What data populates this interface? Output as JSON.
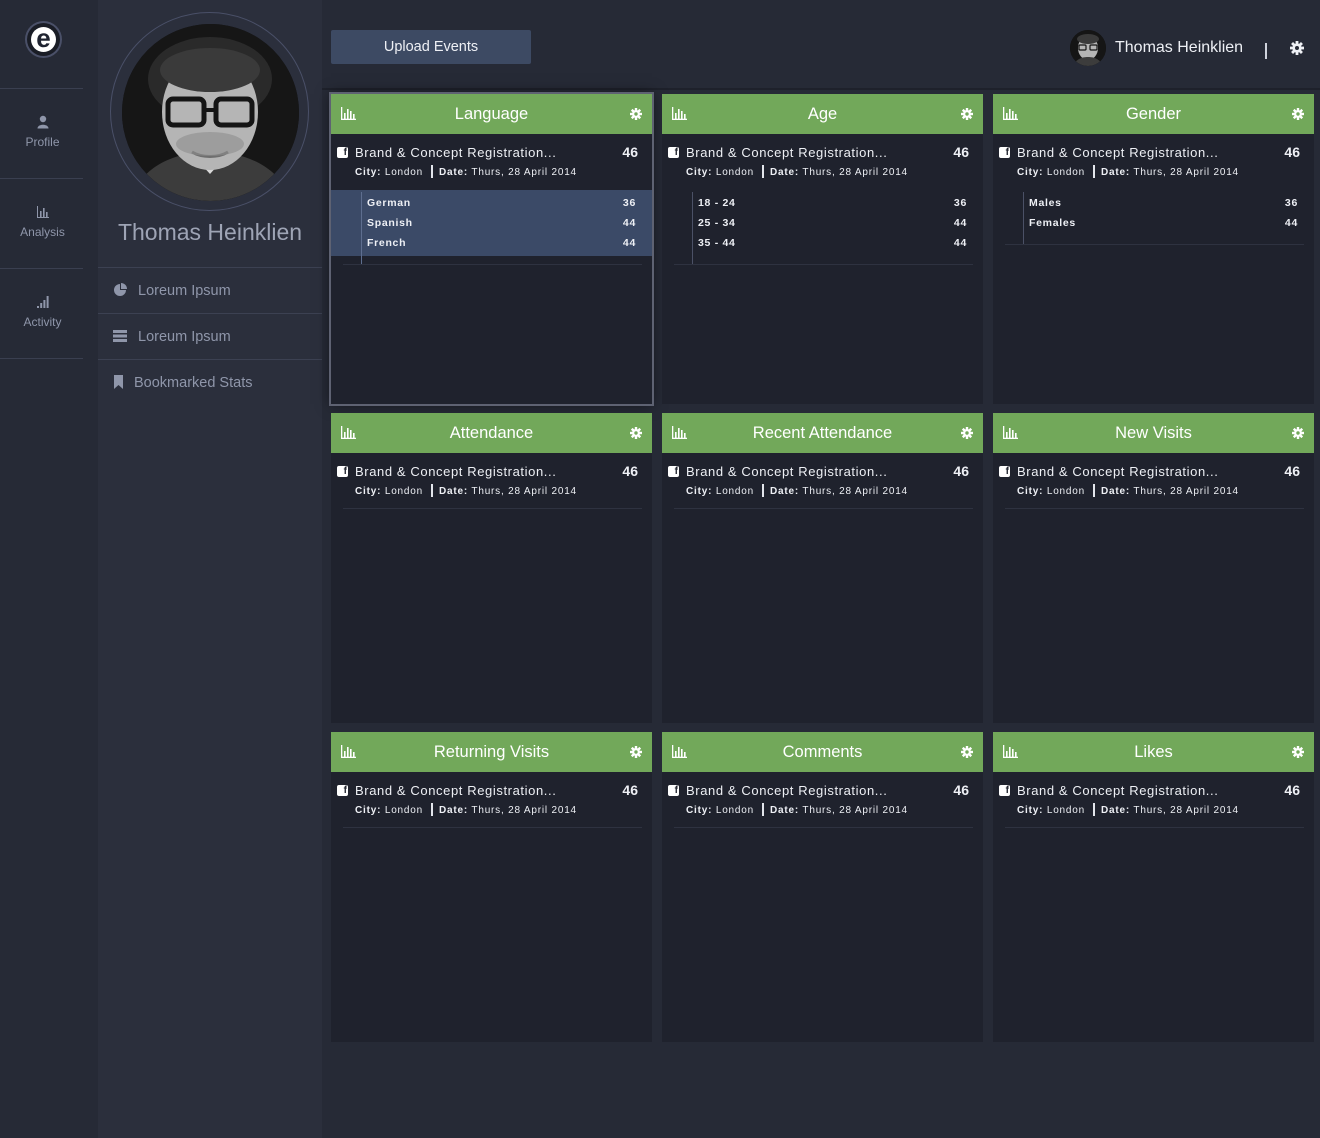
{
  "rail": {
    "logo_letter": "e",
    "items": [
      {
        "label": "Profile",
        "icon": "user-icon"
      },
      {
        "label": "Analysis",
        "icon": "bar-chart-icon"
      },
      {
        "label": "Activity",
        "icon": "signal-bars-icon"
      }
    ]
  },
  "profile": {
    "name": "Thomas Heinklien",
    "menu": [
      {
        "label": "Loreum Ipsum",
        "icon": "pie-chart-icon"
      },
      {
        "label": "Loreum Ipsum",
        "icon": "list-icon"
      },
      {
        "label": "Bookmarked Stats",
        "icon": "bookmark-icon"
      }
    ]
  },
  "topbar": {
    "upload_label": "Upload Events",
    "user_name": "Thomas Heinklien",
    "separator": "|"
  },
  "colors": {
    "accent_green": "#72a85a",
    "selected_row_bg": "#3b4a67",
    "card_bg": "#1f222d",
    "page_bg": "#262a36"
  },
  "cards": [
    {
      "title": "Language",
      "entry": {
        "title": "Brand & Concept Registration...",
        "count": "46",
        "city_label": "City:",
        "city": "London",
        "date_label": "Date:",
        "date": "Thurs, 28 April 2014"
      },
      "rows": [
        {
          "label": "German",
          "value": "36"
        },
        {
          "label": "Spanish",
          "value": "44"
        },
        {
          "label": "French",
          "value": "44"
        }
      ]
    },
    {
      "title": "Age",
      "entry": {
        "title": "Brand & Concept Registration...",
        "count": "46",
        "city_label": "City:",
        "city": "London",
        "date_label": "Date:",
        "date": "Thurs, 28 April 2014"
      },
      "rows": [
        {
          "label": "18 - 24",
          "value": "36"
        },
        {
          "label": "25 - 34",
          "value": "44"
        },
        {
          "label": "35 - 44",
          "value": "44"
        }
      ]
    },
    {
      "title": "Gender",
      "entry": {
        "title": "Brand & Concept Registration...",
        "count": "46",
        "city_label": "City:",
        "city": "London",
        "date_label": "Date:",
        "date": "Thurs, 28 April 2014"
      },
      "rows": [
        {
          "label": "Males",
          "value": "36"
        },
        {
          "label": "Females",
          "value": "44"
        }
      ]
    },
    {
      "title": "Attendance",
      "entry": {
        "title": "Brand & Concept Registration...",
        "count": "46",
        "city_label": "City:",
        "city": "London",
        "date_label": "Date:",
        "date": "Thurs, 28 April 2014"
      },
      "rows": []
    },
    {
      "title": "Recent Attendance",
      "entry": {
        "title": "Brand & Concept Registration...",
        "count": "46",
        "city_label": "City:",
        "city": "London",
        "date_label": "Date:",
        "date": "Thurs, 28 April 2014"
      },
      "rows": []
    },
    {
      "title": "New Visits",
      "entry": {
        "title": "Brand & Concept Registration...",
        "count": "46",
        "city_label": "City:",
        "city": "London",
        "date_label": "Date:",
        "date": "Thurs, 28 April 2014"
      },
      "rows": []
    },
    {
      "title": "Returning Visits",
      "entry": {
        "title": "Brand & Concept Registration...",
        "count": "46",
        "city_label": "City:",
        "city": "London",
        "date_label": "Date:",
        "date": "Thurs, 28 April 2014"
      },
      "rows": []
    },
    {
      "title": "Comments",
      "entry": {
        "title": "Brand & Concept Registration...",
        "count": "46",
        "city_label": "City:",
        "city": "London",
        "date_label": "Date:",
        "date": "Thurs, 28 April 2014"
      },
      "rows": []
    },
    {
      "title": "Likes",
      "entry": {
        "title": "Brand & Concept Registration...",
        "count": "46",
        "city_label": "City:",
        "city": "London",
        "date_label": "Date:",
        "date": "Thurs, 28 April 2014"
      },
      "rows": []
    }
  ]
}
